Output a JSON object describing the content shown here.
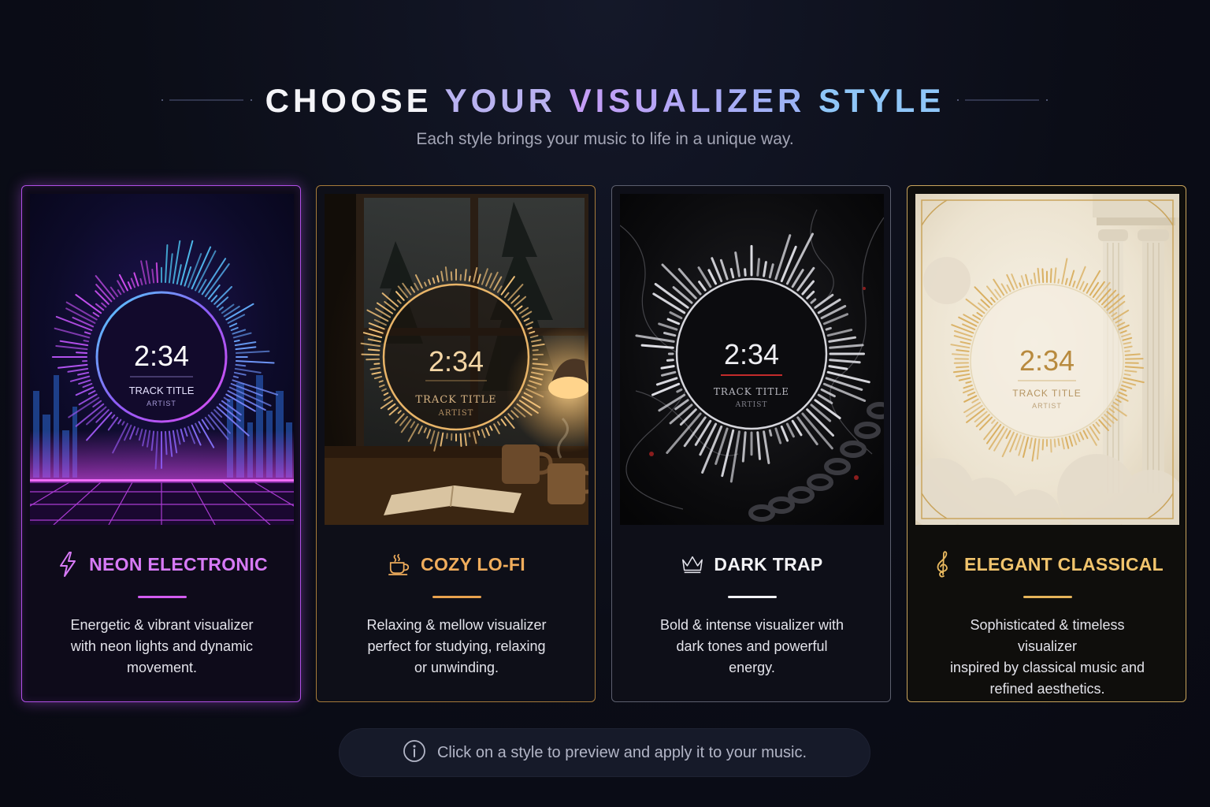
{
  "header": {
    "title_words": [
      "CHOOSE",
      "YOUR",
      "VISUALIZER",
      "STYLE"
    ],
    "subtitle": "Each style brings your music to life in a unique way."
  },
  "cards": [
    {
      "id": "neon",
      "name": "NEON ELECTRONIC",
      "icon": "lightning-bolt-icon",
      "time": "2:34",
      "track_title": "TRACK TITLE",
      "artist": "ARTIST",
      "description": [
        "Energetic & vibrant visualizer",
        "with neon lights and dynamic",
        "movement."
      ],
      "accent": "#d77af7",
      "selected": true
    },
    {
      "id": "lofi",
      "name": "COZY LO-FI",
      "icon": "coffee-cup-icon",
      "time": "2:34",
      "track_title": "TRACK TITLE",
      "artist": "ARTIST",
      "description": [
        "Relaxing & mellow visualizer",
        "perfect for studying, relaxing",
        "or unwinding."
      ],
      "accent": "#f0ad5c"
    },
    {
      "id": "trap",
      "name": "DARK TRAP",
      "icon": "crown-icon",
      "time": "2:34",
      "track_title": "TRACK TITLE",
      "artist": "ARTIST",
      "description": [
        "Bold & intense visualizer with",
        "dark tones and powerful",
        "energy."
      ],
      "accent": "#f2f2f5"
    },
    {
      "id": "classic",
      "name": "ELEGANT CLASSICAL",
      "icon": "treble-clef-icon",
      "time": "2:34",
      "track_title": "TRACK TITLE",
      "artist": "ARTIST",
      "description": [
        "Sophisticated & timeless visualizer",
        "inspired by classical music and",
        "refined aesthetics."
      ],
      "accent": "#f1c46d"
    }
  ],
  "footer": {
    "icon": "info-icon",
    "hint": "Click on a style to preview and apply it to your music."
  },
  "colors": {
    "background": "#0b0d17",
    "neon_accent": "#b14fe6",
    "lofi_accent": "#e8a24e",
    "trap_accent": "#f2f2f5",
    "classic_accent": "#e5b45a"
  }
}
